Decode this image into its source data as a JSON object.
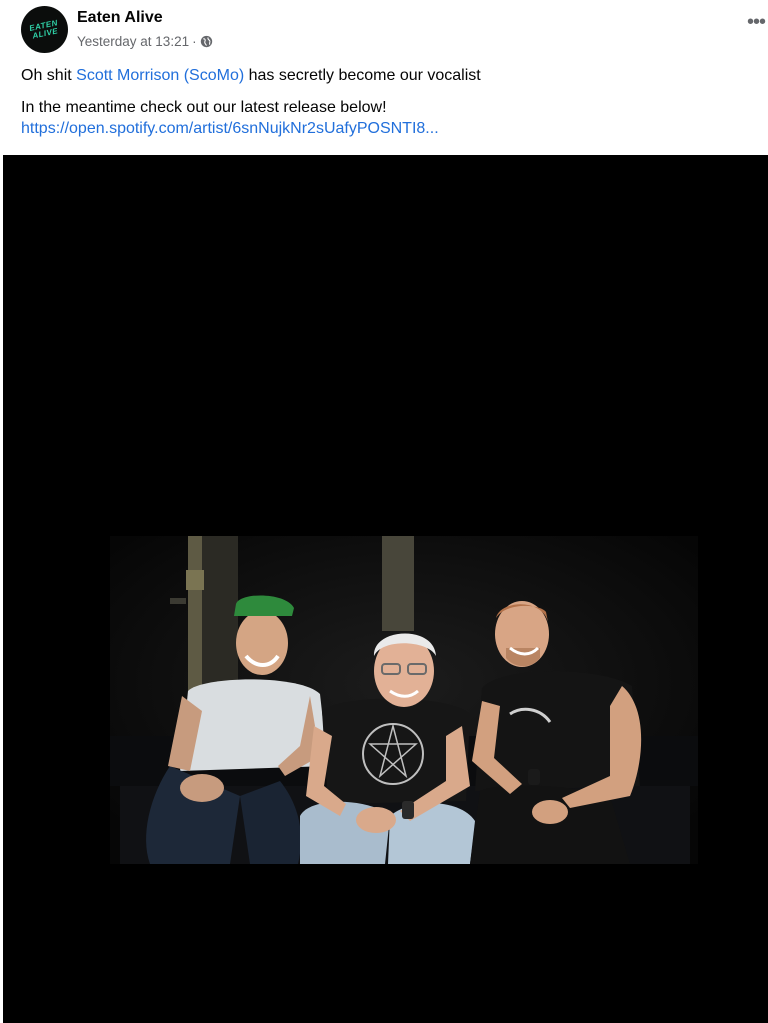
{
  "post": {
    "author": "Eaten Alive",
    "avatar_text": "EATEN ALIVE",
    "timestamp": "Yesterday at 13:21",
    "separator": "·",
    "audience_icon": "globe-icon",
    "more_icon": "•••",
    "text": {
      "line1_prefix": "Oh shit ",
      "mention": "Scott Morrison (ScoMo)",
      "line1_suffix": " has secretly become our vocalist",
      "line2": "In the meantime check out our latest release below!",
      "link": "https://open.spotify.com/artist/6snNujkNr2sUafyPOSNTI8..."
    }
  },
  "colors": {
    "link": "#216fdb",
    "meta": "#65676b",
    "media_bg": "#000000",
    "cap": "#2e8a3c",
    "avatar_logo": "#2fd0a6"
  }
}
